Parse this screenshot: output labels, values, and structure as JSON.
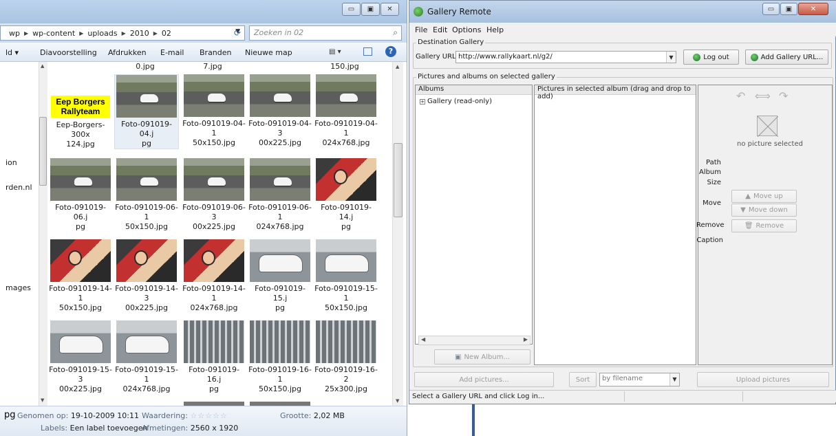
{
  "explorer": {
    "breadcrumb": [
      "wp",
      "wp-content",
      "uploads",
      "2010",
      "02"
    ],
    "search_placeholder": "Zoeken in 02",
    "toolbar": {
      "organize_fragment": "ld",
      "slideshow": "Diavoorstelling",
      "print": "Afdrukken",
      "email": "E-mail",
      "burn": "Branden",
      "new_folder": "Nieuwe map"
    },
    "nav_fragments": [
      "ion",
      "rden.nl",
      "mages"
    ],
    "top_partial_names": [
      "0.jpg",
      "7.jpg",
      "150.jpg"
    ],
    "rows": [
      [
        {
          "name": "Eep-Borgers-300x\n124.jpg",
          "kind": "logo",
          "logo_text": "Eep Borgers\nRallyteam"
        },
        {
          "name": "Foto-091019-04.j\npg",
          "kind": "track",
          "selected": true
        },
        {
          "name": "Foto-091019-04-1\n50x150.jpg",
          "kind": "track"
        },
        {
          "name": "Foto-091019-04-3\n00x225.jpg",
          "kind": "track"
        },
        {
          "name": "Foto-091019-04-1\n024x768.jpg",
          "kind": "track"
        }
      ],
      [
        {
          "name": "Foto-091019-06.j\npg",
          "kind": "track"
        },
        {
          "name": "Foto-091019-06-1\n50x150.jpg",
          "kind": "track"
        },
        {
          "name": "Foto-091019-06-3\n00x225.jpg",
          "kind": "track"
        },
        {
          "name": "Foto-091019-06-1\n024x768.jpg",
          "kind": "track"
        },
        {
          "name": "Foto-091019-14.j\npg",
          "kind": "people"
        }
      ],
      [
        {
          "name": "Foto-091019-14-1\n50x150.jpg",
          "kind": "people"
        },
        {
          "name": "Foto-091019-14-3\n00x225.jpg",
          "kind": "people"
        },
        {
          "name": "Foto-091019-14-1\n024x768.jpg",
          "kind": "people"
        },
        {
          "name": "Foto-091019-15.j\npg",
          "kind": "cars"
        },
        {
          "name": "Foto-091019-15-1\n50x150.jpg",
          "kind": "cars"
        }
      ],
      [
        {
          "name": "Foto-091019-15-3\n00x225.jpg",
          "kind": "cars"
        },
        {
          "name": "Foto-091019-15-1\n024x768.jpg",
          "kind": "cars"
        },
        {
          "name": "Foto-091019-16.j\npg",
          "kind": "grid"
        },
        {
          "name": "Foto-091019-16-1\n50x150.jpg",
          "kind": "grid"
        },
        {
          "name": "Foto-091019-16-2\n25x300.jpg",
          "kind": "grid"
        }
      ]
    ],
    "details": {
      "ext_fragment": "pg",
      "taken_label": "Genomen op:",
      "taken_value": "19-10-2009 10:11",
      "rating_label": "Waardering:",
      "rating_stars": "☆☆☆☆☆",
      "size_label": "Grootte:",
      "size_value": "2,02 MB",
      "labels_label": "Labels:",
      "labels_value": "Een label toevoegen",
      "dims_label": "Afmetingen:",
      "dims_value": "2560 x 1920"
    }
  },
  "gallery": {
    "title": "Gallery Remote",
    "menu": [
      "File",
      "Edit",
      "Options",
      "Help"
    ],
    "destination_legend": "Destination Gallery",
    "url_label": "Gallery URL",
    "url_value": "http://www.rallykaart.nl/g2/",
    "logout_button": "Log out",
    "add_url_button": "Add Gallery URL...",
    "pictures_legend": "Pictures and albums on selected gallery",
    "albums_header": "Albums",
    "album_tree_item": "Gallery (read-only)",
    "pictures_header": "Pictures in selected album (drag and drop to add)",
    "new_album_button": "New Album...",
    "no_picture_text": "no picture selected",
    "props": {
      "path": "Path",
      "album": "Album",
      "size": "Size",
      "move": "Move",
      "remove": "Remove",
      "caption": "Caption"
    },
    "move_up_button": "Move up",
    "move_down_button": "Move down",
    "remove_button": "Remove",
    "add_pictures_button": "Add pictures...",
    "sort_button": "Sort",
    "sort_value": "by filename",
    "upload_button": "Upload pictures",
    "status_text": "Select a Gallery URL and click Log in..."
  }
}
